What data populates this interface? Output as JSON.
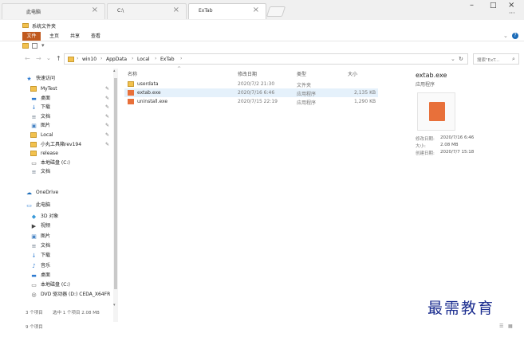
{
  "tabs": [
    {
      "label": "此电脑"
    },
    {
      "label": "C:\\"
    },
    {
      "label": "ExTab"
    }
  ],
  "window_title": "系统文件夹",
  "ribbon": {
    "file": "文件",
    "home": "主页",
    "share": "共享",
    "view": "查看"
  },
  "address": {
    "segments": [
      "win10",
      "AppData",
      "Local",
      "ExTab"
    ],
    "search_placeholder": "搜索\"ExT...",
    "separator": "›"
  },
  "nav": {
    "quick_access": "快速访问",
    "items": [
      {
        "label": "MyTest",
        "icon": "folder-icon",
        "pinned": true
      },
      {
        "label": "桌面",
        "icon": "desktop-icon",
        "pinned": true
      },
      {
        "label": "下载",
        "icon": "download-icon",
        "pinned": true
      },
      {
        "label": "文档",
        "icon": "document-icon",
        "pinned": true
      },
      {
        "label": "图片",
        "icon": "picture-icon",
        "pinned": true
      },
      {
        "label": "Local",
        "icon": "folder-icon",
        "pinned": true
      },
      {
        "label": "小丸工具箱rev194",
        "icon": "folder-icon",
        "pinned": true
      },
      {
        "label": "release",
        "icon": "folder-icon",
        "pinned": false
      },
      {
        "label": "本地磁盘 (C:)",
        "icon": "drive-icon",
        "pinned": false
      },
      {
        "label": "文档",
        "icon": "document-icon",
        "pinned": false
      }
    ],
    "onedrive": "OneDrive",
    "this_pc": "此电脑",
    "pc_items": [
      {
        "label": "3D 对象",
        "icon": "cube-icon"
      },
      {
        "label": "视频",
        "icon": "video-icon"
      },
      {
        "label": "图片",
        "icon": "picture-icon"
      },
      {
        "label": "文档",
        "icon": "document-icon"
      },
      {
        "label": "下载",
        "icon": "download-icon"
      },
      {
        "label": "音乐",
        "icon": "music-icon"
      },
      {
        "label": "桌面",
        "icon": "desktop-icon"
      },
      {
        "label": "本地磁盘 (C:)",
        "icon": "drive-icon"
      },
      {
        "label": "DVD 驱动器 (D:) CEDA_X64FR",
        "icon": "dvd-icon"
      }
    ]
  },
  "columns": {
    "name": "名称",
    "date": "修改日期",
    "type": "类型",
    "size": "大小"
  },
  "files": [
    {
      "name": "userdata",
      "date": "2020/7/2 21:30",
      "type": "文件夹",
      "size": "",
      "icon": "folder-icon",
      "selected": false
    },
    {
      "name": "extab.exe",
      "date": "2020/7/16 6:46",
      "type": "应用程序",
      "size": "2,135 KB",
      "icon": "app-icon",
      "selected": true
    },
    {
      "name": "uninstall.exe",
      "date": "2020/7/15 22:19",
      "type": "应用程序",
      "size": "1,290 KB",
      "icon": "app-icon",
      "selected": false
    }
  ],
  "preview": {
    "filename": "extab.exe",
    "type": "应用程序",
    "modified_label": "修改日期:",
    "modified": "2020/7/16 6:46",
    "size_label": "大小:",
    "size": "2.08 MB",
    "created_label": "创建日期:",
    "created": "2020/7/7 15:18"
  },
  "status": {
    "items": "3 个项目",
    "selected": "选中 1 个项目  2.08 MB",
    "count2": "9 个项目"
  },
  "watermark": "最需教育",
  "colors": {
    "accent": "#c05a1f",
    "selection": "#e5f1fb",
    "folder": "#f2c14e",
    "app": "#e8703a",
    "link": "#1a6bb8",
    "brand": "#1b2d8f"
  }
}
